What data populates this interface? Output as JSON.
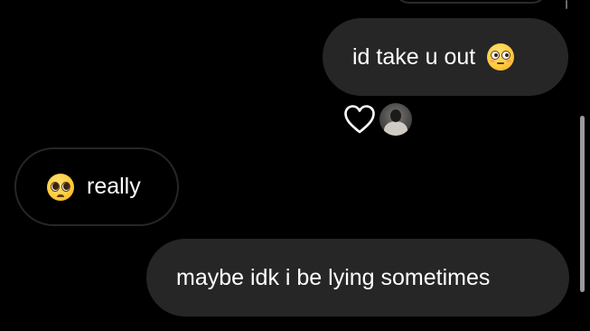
{
  "messages": [
    {
      "direction": "sent",
      "text": "id take u out",
      "emoji": "flushed-face-icon"
    },
    {
      "direction": "received",
      "text": "really",
      "emoji": "pleading-face-icon"
    },
    {
      "direction": "sent",
      "text": "maybe idk i be lying sometimes"
    }
  ],
  "reaction": {
    "icon": "heart-outline-icon",
    "reactor": "avatar"
  },
  "colors": {
    "background": "#000000",
    "sent_bubble": "#262626",
    "received_border": "#262626",
    "text": "#ffffff"
  }
}
